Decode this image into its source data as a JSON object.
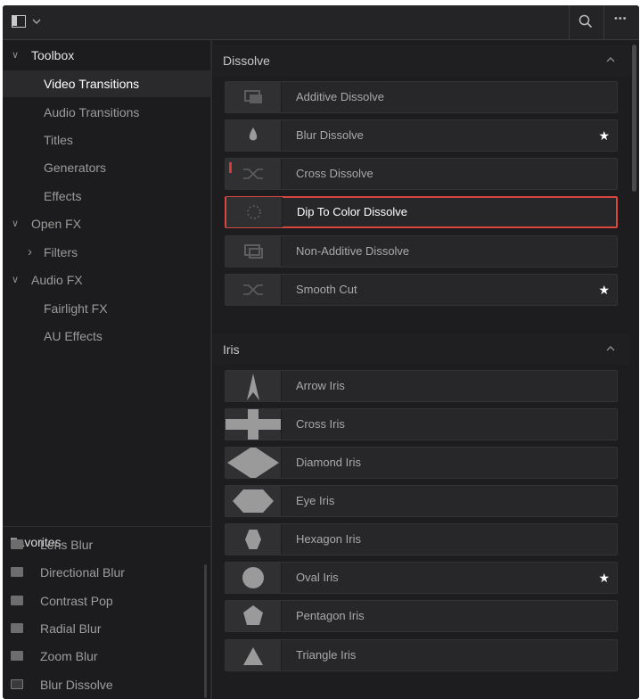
{
  "topbar": {
    "icons": [
      "panel-toggle-icon",
      "chevron-down-icon",
      "search-icon",
      "more-options-icon"
    ],
    "more_glyph": "•••"
  },
  "sidebar": {
    "tree": [
      {
        "label": "Toolbox",
        "expanded": true,
        "level": 0
      },
      {
        "label": "Video Transitions",
        "selected": true,
        "level": 1
      },
      {
        "label": "Audio Transitions",
        "level": 1
      },
      {
        "label": "Titles",
        "level": 1
      },
      {
        "label": "Generators",
        "level": 1
      },
      {
        "label": "Effects",
        "level": 1
      },
      {
        "label": "Open FX",
        "expanded": true,
        "level": 0
      },
      {
        "label": "Filters",
        "expanded": false,
        "level": 1
      },
      {
        "label": "Audio FX",
        "expanded": true,
        "level": 0
      },
      {
        "label": "Fairlight FX",
        "level": 1
      },
      {
        "label": "AU Effects",
        "level": 1
      }
    ],
    "favorites_title": "Favorites",
    "favorites": [
      {
        "label": "Lens Blur",
        "icon": "ofx-icon"
      },
      {
        "label": "Directional Blur",
        "icon": "ofx-icon"
      },
      {
        "label": "Contrast Pop",
        "icon": "ofx-icon"
      },
      {
        "label": "Radial Blur",
        "icon": "ofx-icon"
      },
      {
        "label": "Zoom Blur",
        "icon": "ofx-icon"
      },
      {
        "label": "Blur Dissolve",
        "icon": "transition-icon"
      }
    ]
  },
  "main": {
    "sections": [
      {
        "title": "Dissolve",
        "items": [
          {
            "label": "Additive Dissolve",
            "icon": "additive-dissolve-icon",
            "favorite": false
          },
          {
            "label": "Blur Dissolve",
            "icon": "blur-dissolve-icon",
            "favorite": true
          },
          {
            "label": "Cross Dissolve",
            "icon": "cross-dissolve-icon",
            "favorite": false,
            "marker": true
          },
          {
            "label": "Dip To Color Dissolve",
            "icon": "dip-to-color-icon",
            "favorite": false,
            "selected": true
          },
          {
            "label": "Non-Additive Dissolve",
            "icon": "non-additive-dissolve-icon",
            "favorite": false
          },
          {
            "label": "Smooth Cut",
            "icon": "smooth-cut-icon",
            "favorite": true
          }
        ]
      },
      {
        "title": "Iris",
        "items": [
          {
            "label": "Arrow Iris",
            "icon": "arrow-iris-icon",
            "favorite": false
          },
          {
            "label": "Cross Iris",
            "icon": "cross-iris-icon",
            "favorite": false
          },
          {
            "label": "Diamond Iris",
            "icon": "diamond-iris-icon",
            "favorite": false
          },
          {
            "label": "Eye Iris",
            "icon": "eye-iris-icon",
            "favorite": false
          },
          {
            "label": "Hexagon Iris",
            "icon": "hexagon-iris-icon",
            "favorite": false
          },
          {
            "label": "Oval Iris",
            "icon": "oval-iris-icon",
            "favorite": true
          },
          {
            "label": "Pentagon Iris",
            "icon": "pentagon-iris-icon",
            "favorite": false
          },
          {
            "label": "Triangle Iris",
            "icon": "triangle-iris-icon",
            "favorite": false
          }
        ]
      }
    ],
    "star_glyph": "★"
  },
  "colors": {
    "selection_border": "#d7473f",
    "background": "#1d1d1f",
    "row": "#27272a"
  }
}
